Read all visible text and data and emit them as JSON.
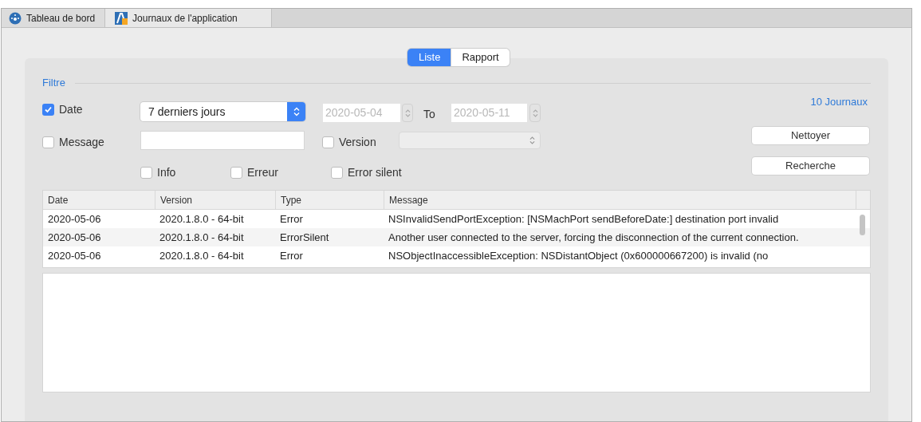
{
  "tabs": [
    {
      "label": "Tableau de bord",
      "selected": false
    },
    {
      "label": "Journaux de l'application",
      "selected": true
    }
  ],
  "view_switch": [
    {
      "label": "Liste",
      "selected": true
    },
    {
      "label": "Rapport",
      "selected": false
    }
  ],
  "filter": {
    "title": "Filtre",
    "count": "10 Journaux",
    "date": {
      "label": "Date",
      "checked": true,
      "period": "7 derniers jours",
      "from": "2020-05-04",
      "to_label": "To",
      "to": "2020-05-11"
    },
    "message": {
      "label": "Message",
      "checked": false
    },
    "version": {
      "label": "Version",
      "checked": false
    },
    "types": [
      {
        "label": "Info",
        "checked": false
      },
      {
        "label": "Erreur",
        "checked": false
      },
      {
        "label": "Error silent",
        "checked": false
      }
    ],
    "buttons": [
      "Nettoyer",
      "Recherche"
    ]
  },
  "table": {
    "columns": [
      "Date",
      "Version",
      "Type",
      "Message"
    ],
    "rows": [
      [
        "2020-05-06",
        "2020.1.8.0 - 64-bit",
        "Error",
        "NSInvalidSendPortException: [NSMachPort sendBeforeDate:] destination port invalid"
      ],
      [
        "2020-05-06",
        "2020.1.8.0 - 64-bit",
        "ErrorSilent",
        "Another user connected to the server, forcing the disconnection of the current connection."
      ],
      [
        "2020-05-06",
        "2020.1.8.0 - 64-bit",
        "Error",
        "NSObjectInaccessibleException: NSDistantObject (0x600000667200) is invalid (no"
      ]
    ]
  }
}
